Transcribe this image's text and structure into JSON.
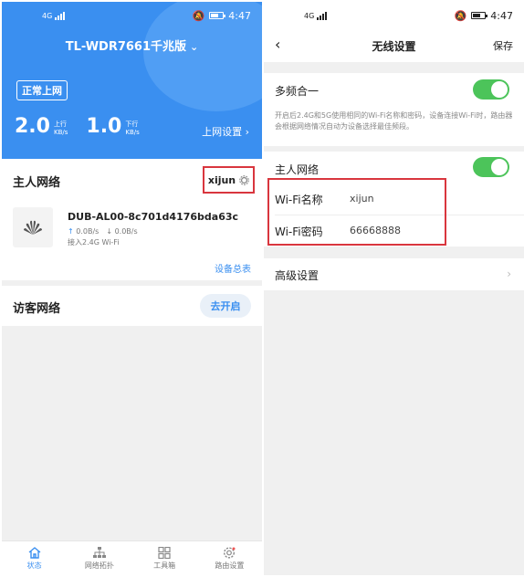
{
  "left": {
    "status": {
      "network": "4G",
      "time": "4:47"
    },
    "router_name": "TL-WDR7661千兆版",
    "online_status": "正常上网",
    "upload": {
      "value": "2.0",
      "label": "上行",
      "unit": "KB/s"
    },
    "download": {
      "value": "1.0",
      "label": "下行",
      "unit": "KB/s"
    },
    "settings_link": "上网设置",
    "host_network": {
      "title": "主人网络",
      "ssid": "xijun",
      "device": {
        "name": "DUB-AL00-8c701d4176bda63c",
        "up": "0.0B/s",
        "down": "0.0B/s",
        "band": "接入2.4G Wi-Fi"
      },
      "summary_link": "设备总表"
    },
    "guest_network": {
      "title": "访客网络",
      "button": "去开启"
    },
    "tabs": [
      {
        "label": "状态",
        "icon": "home-icon"
      },
      {
        "label": "网络拓扑",
        "icon": "topology-icon"
      },
      {
        "label": "工具箱",
        "icon": "toolbox-icon"
      },
      {
        "label": "路由设置",
        "icon": "settings-icon"
      }
    ]
  },
  "right": {
    "status": {
      "network": "4G",
      "time": "4:47"
    },
    "title": "无线设置",
    "save": "保存",
    "multiband": {
      "label": "多频合一",
      "enabled": true
    },
    "note": "开启后2.4G和5G使用相同的Wi-Fi名称和密码，设备连接Wi-Fi时，路由器会根据网络情况自动为设备选择最佳频段。",
    "host_network": {
      "label": "主人网络",
      "enabled": true
    },
    "wifi_name": {
      "label": "Wi-Fi名称",
      "value": "xijun"
    },
    "wifi_password": {
      "label": "Wi-Fi密码",
      "value": "66668888"
    },
    "advanced": "高级设置"
  },
  "colors": {
    "primary": "#3a8ff0",
    "toggle_on": "#4cc45a",
    "highlight": "#d9363e"
  }
}
